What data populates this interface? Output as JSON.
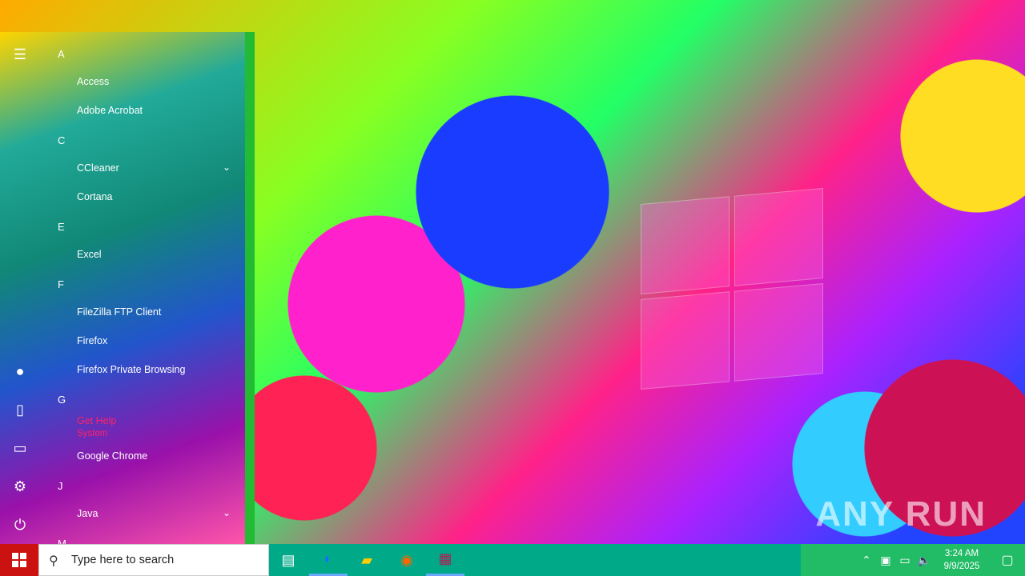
{
  "start_menu": {
    "groups": [
      {
        "letter": "A",
        "apps": [
          "Access",
          "Adobe Acrobat"
        ]
      },
      {
        "letter": "C",
        "apps": [
          "CCleaner",
          "Cortana"
        ]
      },
      {
        "letter": "E",
        "apps": [
          "Excel"
        ]
      },
      {
        "letter": "F",
        "apps": [
          "FileZilla FTP Client",
          "Firefox",
          "Firefox Private Browsing"
        ]
      },
      {
        "letter": "G",
        "apps": [
          "Get Help",
          "Google Chrome"
        ]
      },
      {
        "letter": "J",
        "apps": [
          "Java"
        ]
      },
      {
        "letter": "M",
        "apps": []
      }
    ],
    "get_help_subtitle": "System"
  },
  "taskbar": {
    "search_placeholder": "Type here to search",
    "time": "3:24 AM",
    "date": "9/9/2025"
  },
  "watermark": "ANY RUN",
  "icons": {
    "hamburger": "hamburger-icon",
    "user": "user-icon",
    "documents": "document-icon",
    "pictures": "pictures-icon",
    "settings": "gear-icon",
    "power": "power-icon"
  }
}
